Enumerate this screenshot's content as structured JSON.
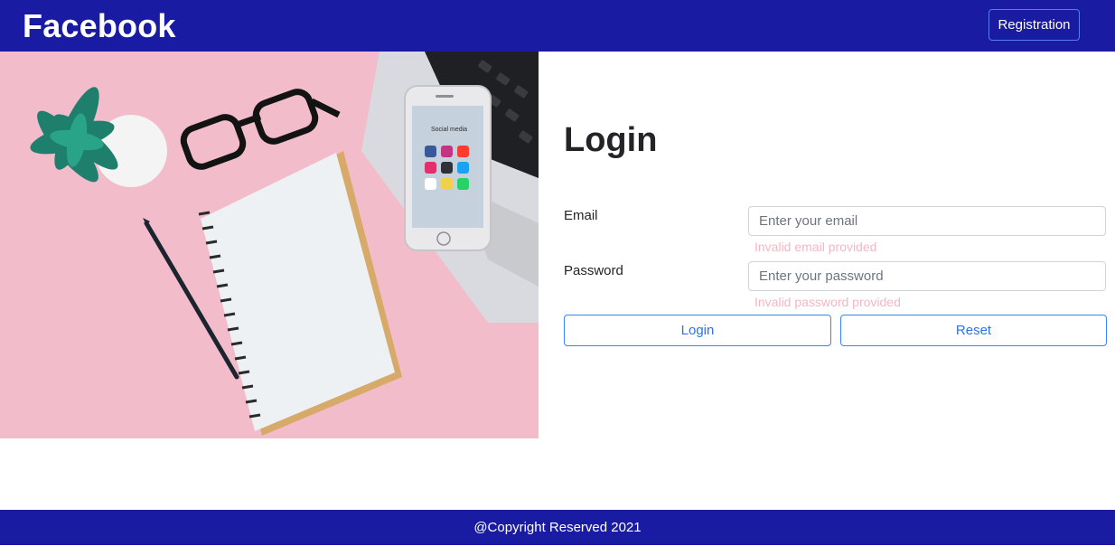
{
  "navbar": {
    "brand": "Facebook",
    "registration_label": "Registration"
  },
  "hero": {
    "phone_screen_label": "Social media"
  },
  "login": {
    "title": "Login",
    "email_label": "Email",
    "email_placeholder": "Enter your email",
    "email_value": "",
    "email_error": "Invalid email provided",
    "password_label": "Password",
    "password_placeholder": "Enter your password",
    "password_value": "",
    "password_error": "Invalid password provided",
    "login_button": "Login",
    "reset_button": "Reset"
  },
  "footer": {
    "copyright": "@Copyright Reserved 2021"
  },
  "colors": {
    "navbar_bg": "#1a1ba3",
    "button_border": "#3a86f0",
    "error_text": "#f6b6c4",
    "hero_bg": "#f0b9c8"
  }
}
